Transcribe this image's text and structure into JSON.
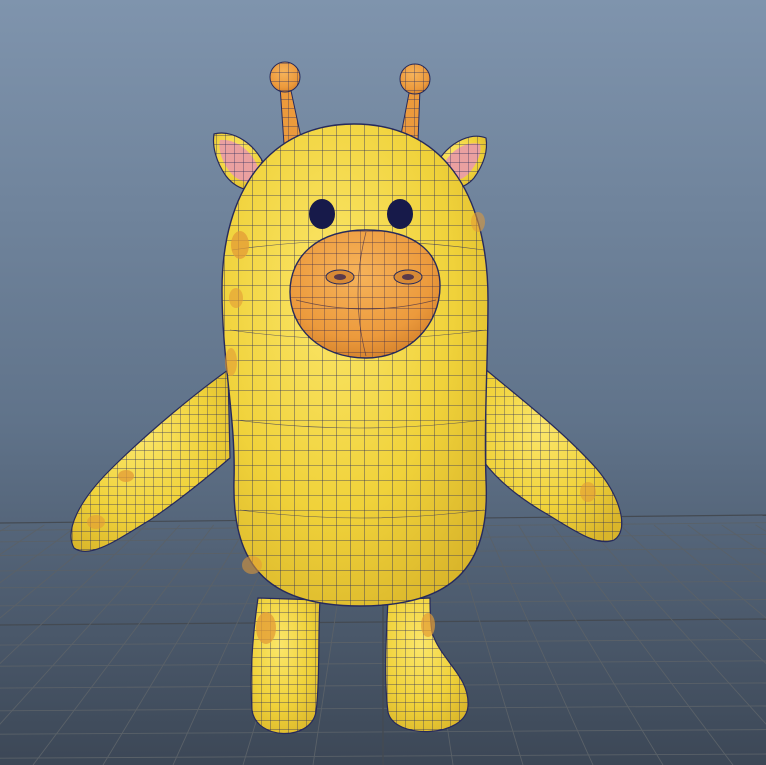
{
  "viewport": {
    "background_top": "#7f94ad",
    "background_mid": "#60738a",
    "background_bottom": "#3c4756",
    "grid_color": "#5a6168",
    "grid_major_color": "#444a52"
  },
  "model": {
    "name": "",
    "body_color": "#f0d23a",
    "body_shade": "#d9b52a",
    "snout_color": "#ec9a3c",
    "snout_shade": "#d27f2a",
    "ear_inner_color": "#eaa0a0",
    "spot_color": "#e39b35",
    "eye_color": "#171a4a",
    "wire_color": "#262a5c"
  }
}
